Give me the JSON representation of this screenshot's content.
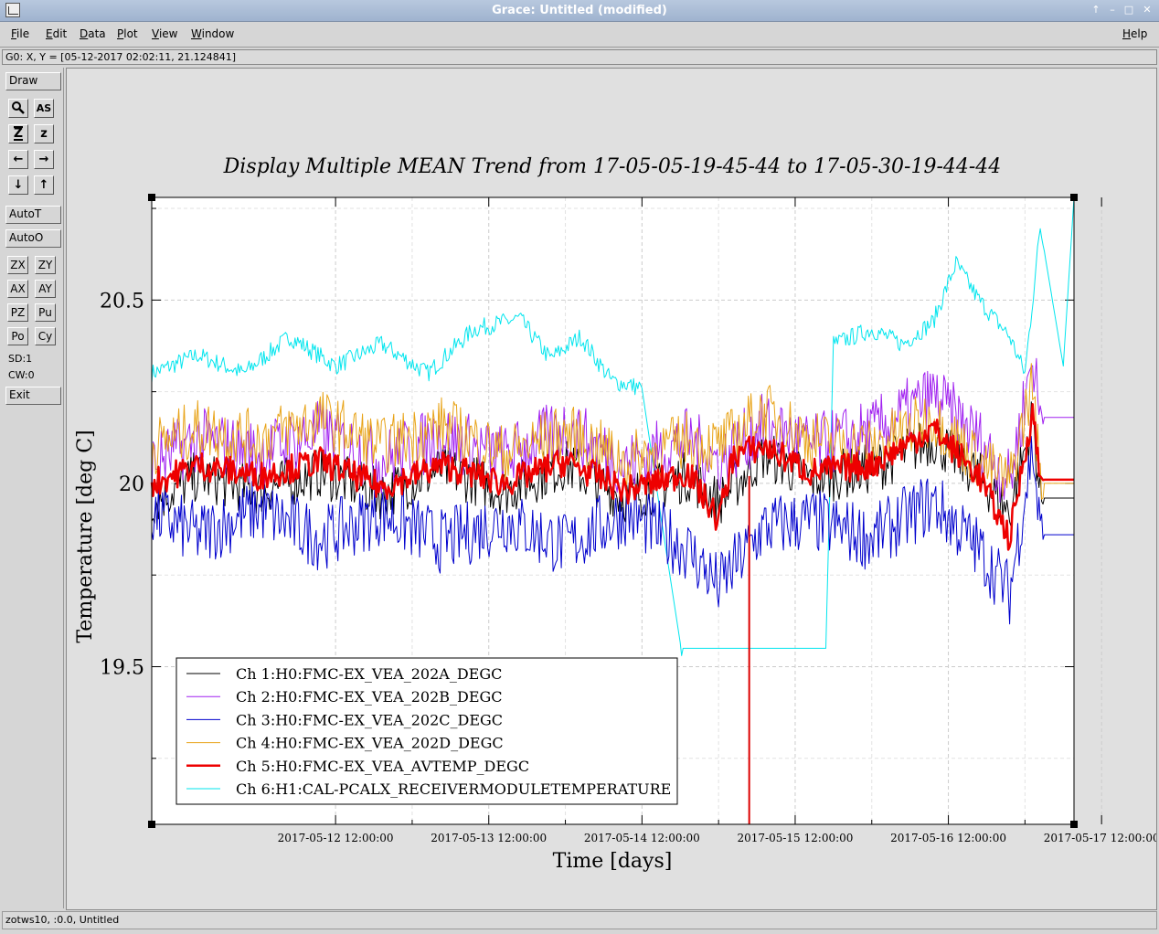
{
  "window": {
    "title": "Grace: Untitled (modified)",
    "controls": [
      "↑",
      "–",
      "□",
      "✕"
    ]
  },
  "menubar": {
    "items": [
      "File",
      "Edit",
      "Data",
      "Plot",
      "View",
      "Window"
    ],
    "help": "Help"
  },
  "locator": {
    "text": "G0: X, Y = [05-12-2017 02:02:11, 21.124841]"
  },
  "toolbar": {
    "draw": "Draw",
    "icon_buttons": [
      {
        "name": "zoom-icon",
        "glyph": "🔍"
      },
      {
        "name": "autoscale-text-icon",
        "glyph": "AS"
      },
      {
        "name": "zoom-in-icon",
        "glyph": "Z"
      },
      {
        "name": "zoom-out-icon",
        "glyph": "z"
      },
      {
        "name": "arrow-left-icon",
        "glyph": "←"
      },
      {
        "name": "arrow-right-icon",
        "glyph": "→"
      },
      {
        "name": "arrow-down-icon",
        "glyph": "↓"
      },
      {
        "name": "arrow-up-icon",
        "glyph": "↑"
      }
    ],
    "autot": "AutoT",
    "autoo": "AutoO",
    "small_buttons": [
      "ZX",
      "ZY",
      "AX",
      "AY",
      "PZ",
      "Pu",
      "Po",
      "Cy"
    ],
    "sd": "SD:1",
    "cw": "CW:0",
    "exit": "Exit"
  },
  "footer": {
    "text": "zotws10, :0.0, Untitled"
  },
  "chart_data": {
    "type": "line",
    "title": "Display Multiple MEAN Trend from 17-05-05-19-45-44 to 17-05-30-19-44-44",
    "xlabel": "Time [days]",
    "ylabel": "Temperature [deg C]",
    "x_ticks": [
      "2017-05-12 12:00:00",
      "2017-05-13 12:00:00",
      "2017-05-14 12:00:00",
      "2017-05-15 12:00:00",
      "2017-05-16 12:00:00",
      "2017-05-17 12:00:00"
    ],
    "x_range_days": [
      11.3,
      17.32
    ],
    "y_ticks": [
      19.5,
      20,
      20.5
    ],
    "ylim": [
      19.07,
      20.78
    ],
    "grid": true,
    "legend_position": "bottom-left",
    "series": [
      {
        "name": "Ch 1:H0:FMC-EX_VEA_202A_DEGC",
        "color": "#000000",
        "points": [
          [
            11.3,
            19.95
          ],
          [
            11.6,
            20.02
          ],
          [
            12.0,
            19.98
          ],
          [
            12.4,
            20.03
          ],
          [
            12.8,
            19.97
          ],
          [
            13.2,
            20.04
          ],
          [
            13.6,
            19.98
          ],
          [
            14.0,
            20.05
          ],
          [
            14.4,
            19.96
          ],
          [
            14.8,
            20.02
          ],
          [
            15.0,
            19.95
          ],
          [
            15.3,
            20.08
          ],
          [
            15.6,
            20.01
          ],
          [
            16.0,
            20.04
          ],
          [
            16.4,
            20.12
          ],
          [
            16.7,
            20.02
          ],
          [
            16.9,
            19.92
          ],
          [
            17.05,
            20.18
          ],
          [
            17.1,
            19.96
          ],
          [
            17.32,
            19.96
          ]
        ]
      },
      {
        "name": "Ch 2:H0:FMC-EX_VEA_202B_DEGC",
        "color": "#a020f0",
        "points": [
          [
            11.3,
            20.05
          ],
          [
            11.6,
            20.12
          ],
          [
            12.0,
            20.08
          ],
          [
            12.4,
            20.14
          ],
          [
            12.8,
            20.06
          ],
          [
            13.2,
            20.13
          ],
          [
            13.6,
            20.07
          ],
          [
            14.0,
            20.15
          ],
          [
            14.4,
            20.05
          ],
          [
            14.8,
            20.12
          ],
          [
            15.0,
            20.06
          ],
          [
            15.3,
            20.16
          ],
          [
            15.6,
            20.1
          ],
          [
            16.0,
            20.14
          ],
          [
            16.4,
            20.24
          ],
          [
            16.7,
            20.12
          ],
          [
            16.9,
            20.0
          ],
          [
            17.05,
            20.35
          ],
          [
            17.1,
            20.18
          ],
          [
            17.32,
            20.18
          ]
        ]
      },
      {
        "name": "Ch 3:H0:FMC-EX_VEA_202C_DEGC",
        "color": "#0000cd",
        "points": [
          [
            11.3,
            19.92
          ],
          [
            11.6,
            19.86
          ],
          [
            12.0,
            19.93
          ],
          [
            12.4,
            19.85
          ],
          [
            12.8,
            19.92
          ],
          [
            13.2,
            19.84
          ],
          [
            13.6,
            19.9
          ],
          [
            14.0,
            19.83
          ],
          [
            14.4,
            19.92
          ],
          [
            14.8,
            19.82
          ],
          [
            15.0,
            19.72
          ],
          [
            15.3,
            19.88
          ],
          [
            15.6,
            19.9
          ],
          [
            16.0,
            19.85
          ],
          [
            16.4,
            19.95
          ],
          [
            16.7,
            19.82
          ],
          [
            16.9,
            19.7
          ],
          [
            17.05,
            20.1
          ],
          [
            17.1,
            19.86
          ],
          [
            17.32,
            19.86
          ]
        ]
      },
      {
        "name": "Ch 4:H0:FMC-EX_VEA_202D_DEGC",
        "color": "#e8a317",
        "points": [
          [
            11.3,
            20.1
          ],
          [
            11.6,
            20.15
          ],
          [
            12.0,
            20.12
          ],
          [
            12.4,
            20.18
          ],
          [
            12.8,
            20.1
          ],
          [
            13.2,
            20.16
          ],
          [
            13.6,
            20.08
          ],
          [
            14.0,
            20.14
          ],
          [
            14.4,
            20.06
          ],
          [
            14.8,
            20.12
          ],
          [
            15.0,
            20.1
          ],
          [
            15.3,
            20.2
          ],
          [
            15.6,
            20.12
          ],
          [
            16.0,
            20.1
          ],
          [
            16.4,
            20.18
          ],
          [
            16.7,
            20.06
          ],
          [
            16.9,
            20.0
          ],
          [
            17.05,
            20.28
          ],
          [
            17.1,
            20.0
          ],
          [
            17.32,
            20.0
          ]
        ]
      },
      {
        "name": "Ch 5:H0:FMC-EX_VEA_AVTEMP_DEGC",
        "color": "#ee0000",
        "points": [
          [
            11.3,
            20.0
          ],
          [
            11.6,
            20.05
          ],
          [
            12.0,
            20.02
          ],
          [
            12.4,
            20.06
          ],
          [
            12.8,
            19.99
          ],
          [
            13.2,
            20.05
          ],
          [
            13.6,
            20.0
          ],
          [
            14.0,
            20.06
          ],
          [
            14.4,
            19.98
          ],
          [
            14.8,
            20.03
          ],
          [
            15.0,
            19.9
          ],
          [
            15.1,
            20.08
          ],
          [
            15.3,
            20.1
          ],
          [
            15.6,
            20.03
          ],
          [
            16.0,
            20.05
          ],
          [
            16.4,
            20.15
          ],
          [
            16.7,
            20.02
          ],
          [
            16.9,
            19.85
          ],
          [
            17.05,
            20.2
          ],
          [
            17.1,
            20.01
          ],
          [
            17.32,
            20.01
          ]
        ]
      },
      {
        "name": "Ch 6:H1:CAL-PCALX_RECEIVERMODULETEMPERATURE",
        "color": "#00e5ee",
        "points": [
          [
            11.3,
            20.3
          ],
          [
            11.6,
            20.35
          ],
          [
            11.9,
            20.3
          ],
          [
            12.2,
            20.4
          ],
          [
            12.5,
            20.32
          ],
          [
            12.8,
            20.38
          ],
          [
            13.1,
            20.3
          ],
          [
            13.4,
            20.42
          ],
          [
            13.7,
            20.45
          ],
          [
            13.9,
            20.34
          ],
          [
            14.1,
            20.4
          ],
          [
            14.3,
            20.28
          ],
          [
            14.5,
            20.26
          ],
          [
            14.75,
            19.55
          ],
          [
            15.7,
            19.55
          ],
          [
            15.75,
            20.38
          ],
          [
            16.0,
            20.42
          ],
          [
            16.2,
            20.38
          ],
          [
            16.4,
            20.44
          ],
          [
            16.55,
            20.6
          ],
          [
            16.7,
            20.5
          ],
          [
            16.9,
            20.4
          ],
          [
            17.0,
            20.3
          ],
          [
            17.1,
            20.7
          ],
          [
            17.25,
            20.32
          ],
          [
            17.32,
            20.78
          ]
        ]
      }
    ],
    "vline": {
      "x_days": 15.2,
      "color": "#dd0000"
    }
  }
}
